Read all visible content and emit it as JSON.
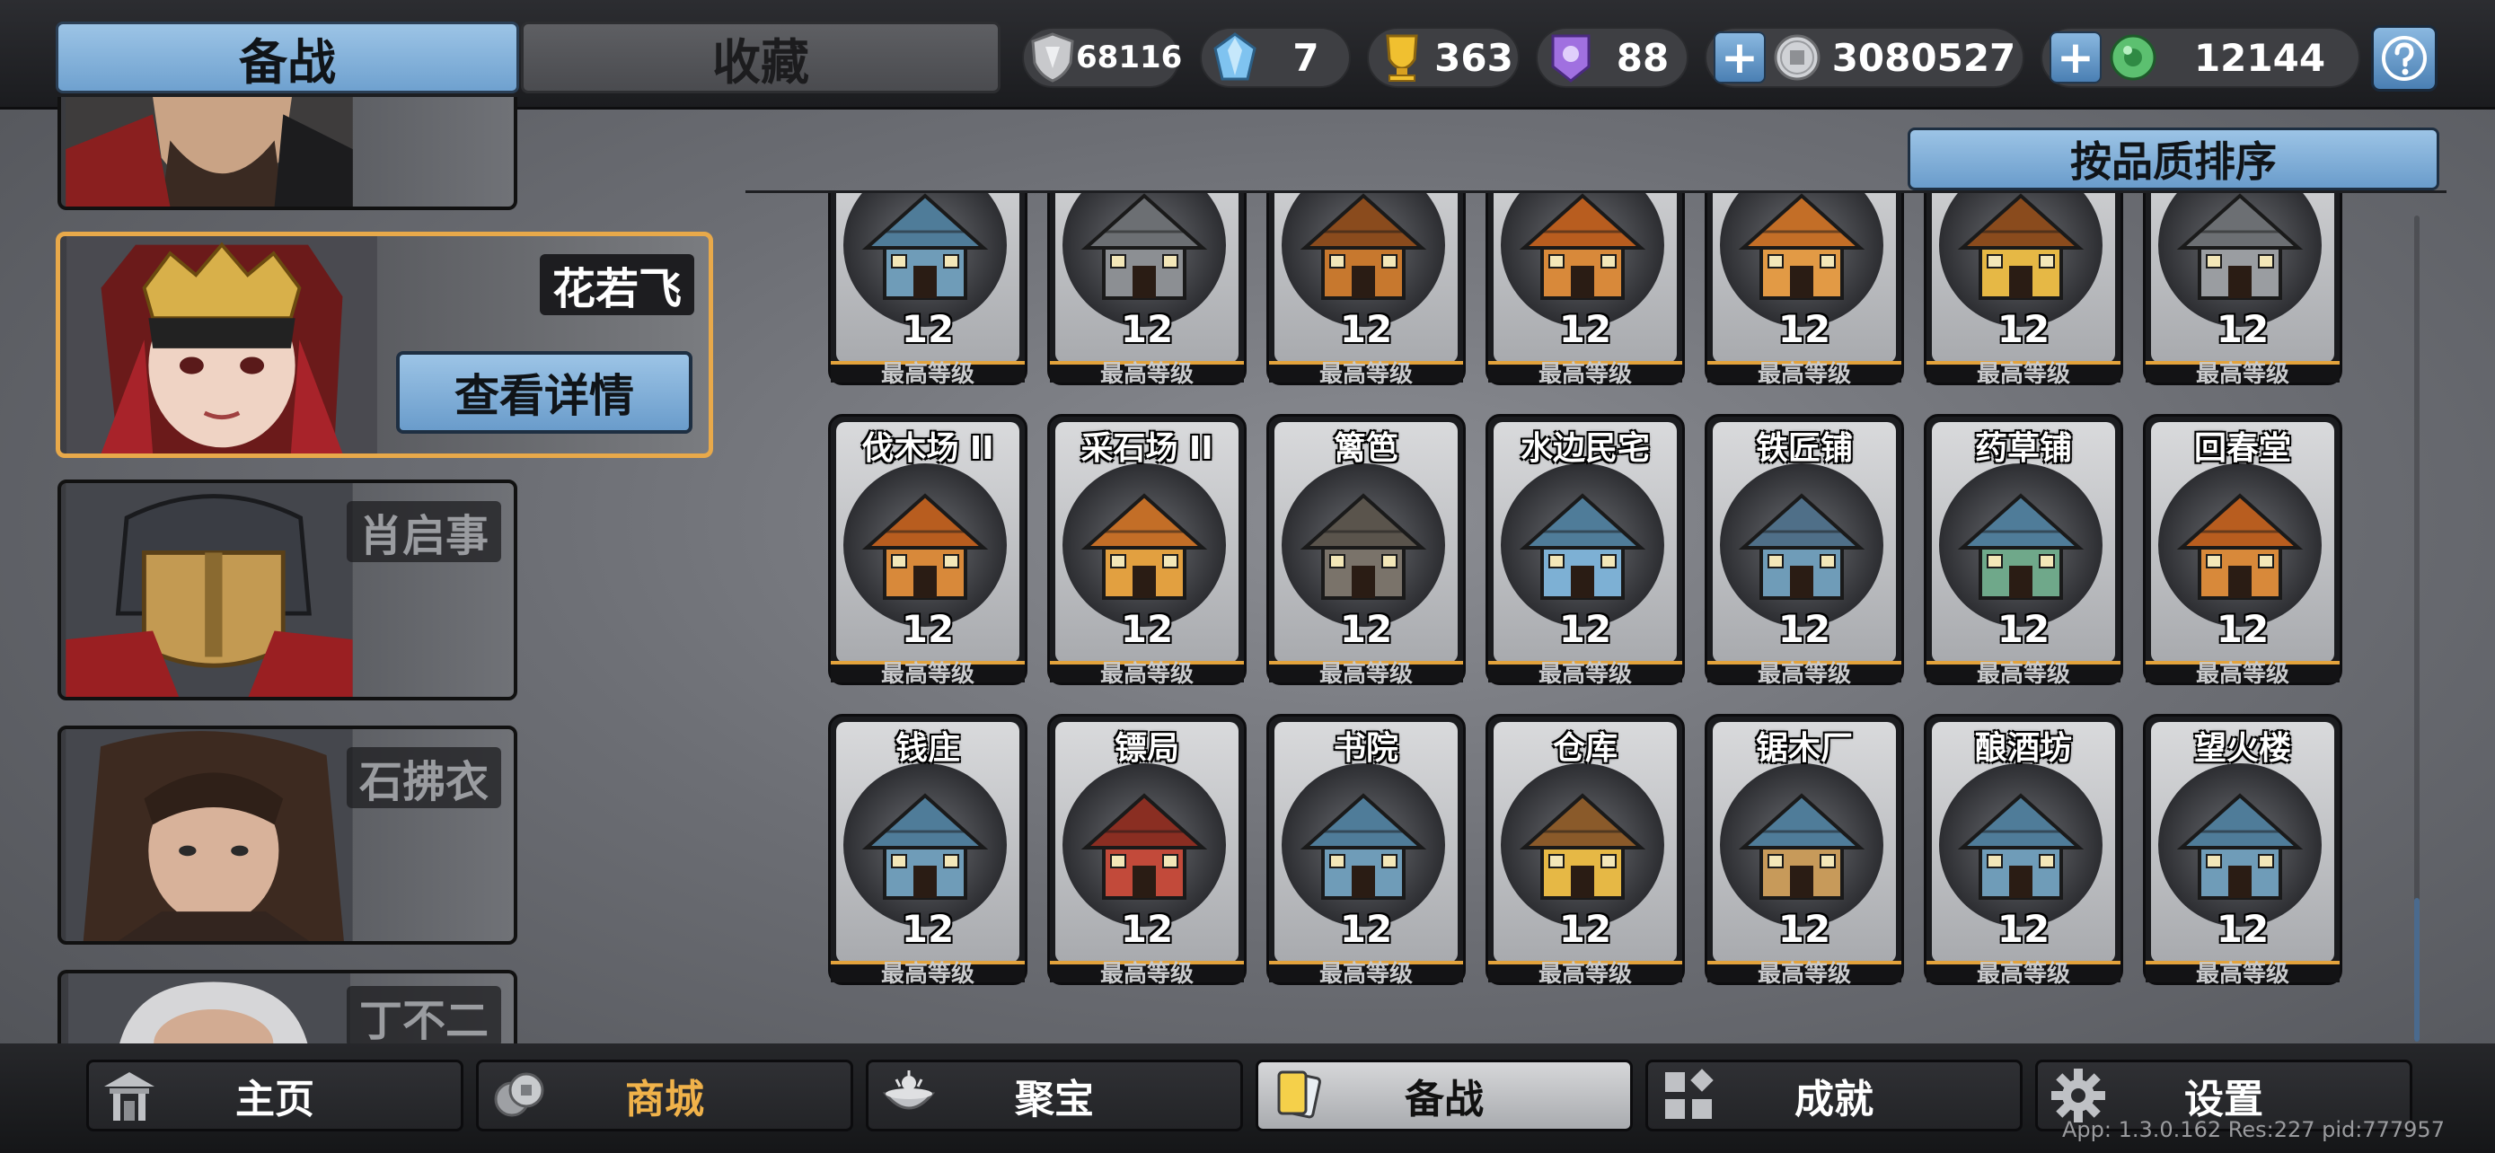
{
  "tabs": {
    "active": "备战",
    "inactive": "收藏"
  },
  "resources": [
    {
      "icon": "silver-shield-icon",
      "value": "68116",
      "color": "#c8c9cc"
    },
    {
      "icon": "blue-crystal-icon",
      "value": "7",
      "color": "#7fc3f0"
    },
    {
      "icon": "gold-trophy-icon",
      "value": "363",
      "color": "#f0c030"
    },
    {
      "icon": "purple-token-icon",
      "value": "88",
      "color": "#a070e0"
    },
    {
      "icon": "silver-coin-icon",
      "value": "3080527",
      "color": "#d0d2d6"
    },
    {
      "icon": "green-jade-icon",
      "value": "12144",
      "color": "#5cc070"
    }
  ],
  "heroes": [
    {
      "name": "",
      "selected": false
    },
    {
      "name": "花若飞",
      "selected": true,
      "detail_label": "查看详情"
    },
    {
      "name": "肖启事",
      "selected": false
    },
    {
      "name": "石拂衣",
      "selected": false
    },
    {
      "name": "丁不二",
      "selected": false
    }
  ],
  "sort_label": "按品质排序",
  "max_level_label": "最高等级",
  "buildings": [
    {
      "name": "",
      "level": "12",
      "theme": "#6f9cb8",
      "roof": "#4f7c99"
    },
    {
      "name": "",
      "level": "12",
      "theme": "#8c8f93",
      "roof": "#6c6f73"
    },
    {
      "name": "",
      "level": "12",
      "theme": "#c7782e",
      "roof": "#8a4b1d"
    },
    {
      "name": "",
      "level": "12",
      "theme": "#d8893a",
      "roof": "#b85d1f"
    },
    {
      "name": "",
      "level": "12",
      "theme": "#e29a45",
      "roof": "#c36e27"
    },
    {
      "name": "",
      "level": "12",
      "theme": "#e6b845",
      "roof": "#8a4b1d"
    },
    {
      "name": "",
      "level": "12",
      "theme": "#9a9da1",
      "roof": "#6c6f73"
    },
    {
      "name": "伐木场 II",
      "level": "12",
      "theme": "#d8893a",
      "roof": "#b85d1f"
    },
    {
      "name": "采石场 II",
      "level": "12",
      "theme": "#e2a040",
      "roof": "#c36e27"
    },
    {
      "name": "篱笆",
      "level": "12",
      "theme": "#7a736a",
      "roof": "#5a544c"
    },
    {
      "name": "水边民宅",
      "level": "12",
      "theme": "#7db0d4",
      "roof": "#4f7c99"
    },
    {
      "name": "铁匠铺",
      "level": "12",
      "theme": "#6f9cb8",
      "roof": "#4f6f88"
    },
    {
      "name": "药草铺",
      "level": "12",
      "theme": "#6fa88a",
      "roof": "#4f7c99"
    },
    {
      "name": "回春堂",
      "level": "12",
      "theme": "#d8893a",
      "roof": "#b85d1f"
    },
    {
      "name": "钱庄",
      "level": "12",
      "theme": "#6f9cb8",
      "roof": "#4f7c99"
    },
    {
      "name": "镖局",
      "level": "12",
      "theme": "#c24a3a",
      "roof": "#8a2e22"
    },
    {
      "name": "书院",
      "level": "12",
      "theme": "#6f9cb8",
      "roof": "#4f7c99"
    },
    {
      "name": "仓库",
      "level": "12",
      "theme": "#e6b845",
      "roof": "#8a5a2a"
    },
    {
      "name": "锯木厂",
      "level": "12",
      "theme": "#c79a5a",
      "roof": "#4f7c99"
    },
    {
      "name": "酿酒坊",
      "level": "12",
      "theme": "#6f9cb8",
      "roof": "#4f7c99"
    },
    {
      "name": "望火楼",
      "level": "12",
      "theme": "#6f9cb8",
      "roof": "#4f7c99"
    }
  ],
  "nav": [
    {
      "label": "主页",
      "icon": "home-gate-icon"
    },
    {
      "label": "商城",
      "icon": "coins-icon"
    },
    {
      "label": "聚宝",
      "icon": "treasure-bowl-icon"
    },
    {
      "label": "备战",
      "icon": "cards-icon",
      "active": true
    },
    {
      "label": "成就",
      "icon": "achievement-grid-icon"
    },
    {
      "label": "设置",
      "icon": "gear-icon"
    }
  ],
  "version": "App: 1.3.0.162 Res:227 pid:777957"
}
